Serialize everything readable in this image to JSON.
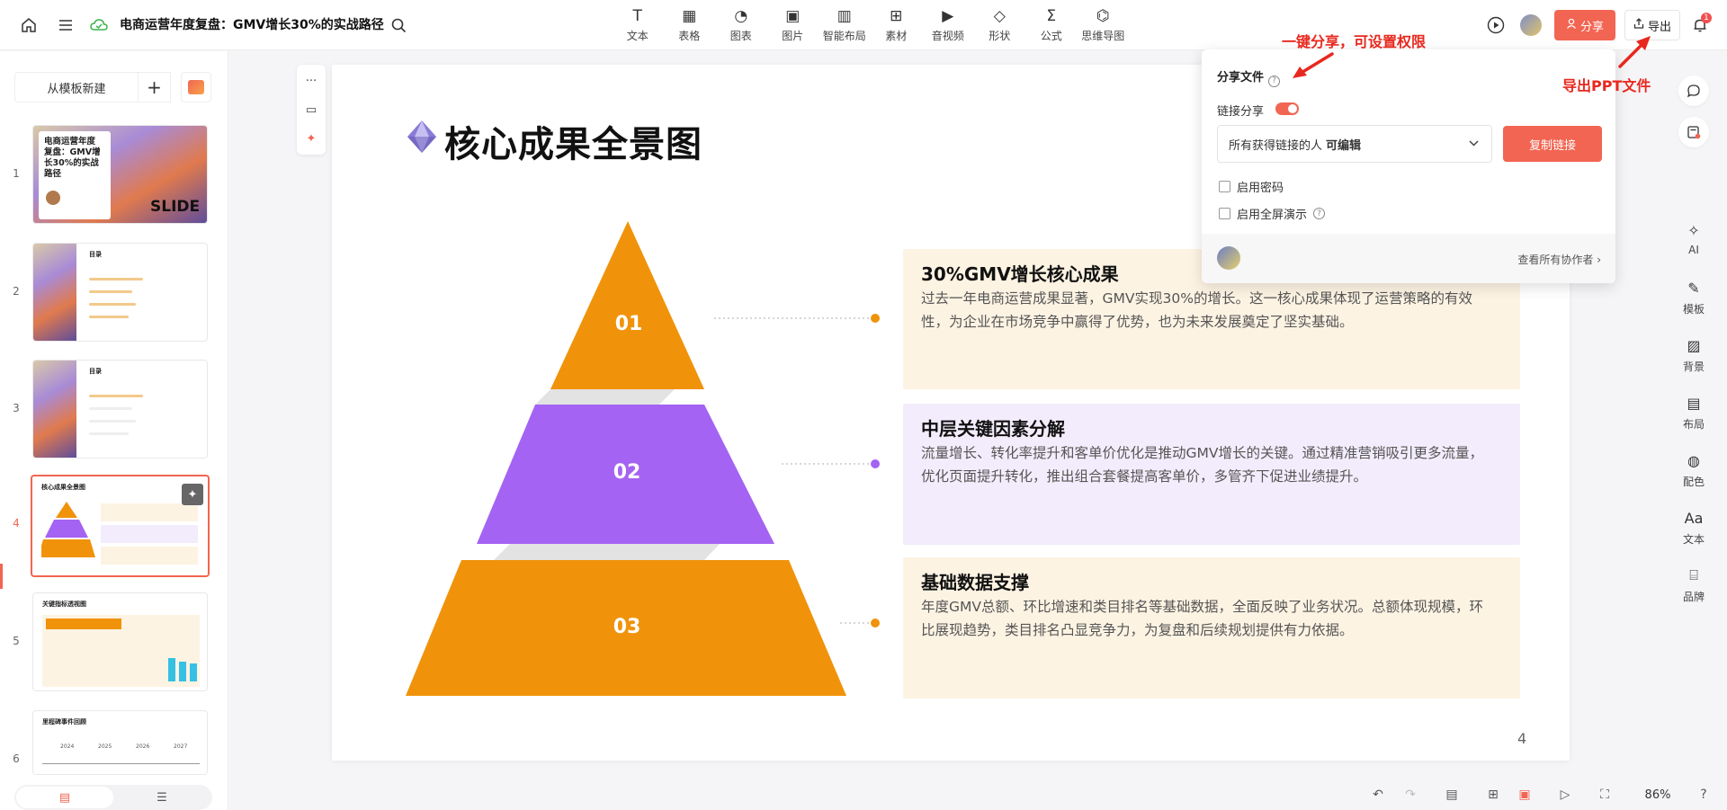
{
  "header": {
    "title": "电商运营年度复盘：GMV增长30%的实战路径",
    "tools": [
      {
        "label": "文本",
        "icon": "T"
      },
      {
        "label": "表格",
        "icon": "▦"
      },
      {
        "label": "图表",
        "icon": "◔"
      },
      {
        "label": "图片",
        "icon": "▣"
      },
      {
        "label": "智能布局",
        "icon": "▥"
      },
      {
        "label": "素材",
        "icon": "⊞"
      },
      {
        "label": "音视频",
        "icon": "▶"
      },
      {
        "label": "形状",
        "icon": "◇"
      },
      {
        "label": "公式",
        "icon": "Σ"
      },
      {
        "label": "思维导图",
        "icon": "⌬"
      }
    ],
    "share_label": "分享",
    "export_label": "导出",
    "notification_count": "1"
  },
  "left_panel": {
    "new_from_template": "从模板新建",
    "slides": [
      {
        "num": "1",
        "title": "电商运营年度复盘：GMV增长30%的实战路径",
        "tag": "SLIDE"
      },
      {
        "num": "2",
        "title": "目录"
      },
      {
        "num": "3",
        "title": "目录"
      },
      {
        "num": "4",
        "title": "核心成果全景图"
      },
      {
        "num": "5",
        "title": "关键指标透视图"
      },
      {
        "num": "6",
        "title": "里程碑事件回顾",
        "years": [
          "2024",
          "2025",
          "2026",
          "2027"
        ]
      }
    ]
  },
  "slide": {
    "title": "核心成果全景图",
    "page_number": "4",
    "levels": [
      {
        "num": "01",
        "color": "#f0930a",
        "card_bg": "#fdf3e3",
        "title": "30%GMV增长核心成果",
        "body": "过去一年电商运营成果显著，GMV实现30%的增长。这一核心成果体现了运营策略的有效性，为企业在市场竞争中赢得了优势，也为未来发展奠定了坚实基础。"
      },
      {
        "num": "02",
        "color": "#a463f2",
        "card_bg": "#f3ecfc",
        "title": "中层关键因素分解",
        "body": "流量增长、转化率提升和客单价优化是推动GMV增长的关键。通过精准营销吸引更多流量，优化页面提升转化，推出组合套餐提高客单价，多管齐下促进业绩提升。"
      },
      {
        "num": "03",
        "color": "#f0930a",
        "card_bg": "#fdf3e3",
        "title": "基础数据支撑",
        "body": "年度GMV总额、环比增速和类目排名等基础数据，全面反映了业务状况。总额体现规模，环比展现趋势，类目排名凸显竞争力，为复盘和后续规划提供有力依据。"
      }
    ]
  },
  "share_popover": {
    "title": "分享文件",
    "link_share_label": "链接分享",
    "permission_prefix": "所有获得链接的人",
    "permission_value": "可编辑",
    "copy_link": "复制链接",
    "enable_password": "启用密码",
    "enable_fullscreen": "启用全屏演示",
    "view_all_collaborators": "查看所有协作者"
  },
  "annotations": {
    "share_note": "一键分享，可设置权限",
    "export_note": "导出PPT文件"
  },
  "right_panel": {
    "items": [
      {
        "label": "AI",
        "icon": "✧"
      },
      {
        "label": "模板",
        "icon": "✎"
      },
      {
        "label": "背景",
        "icon": "▨"
      },
      {
        "label": "布局",
        "icon": "▤"
      },
      {
        "label": "配色",
        "icon": "◍"
      },
      {
        "label": "文本",
        "icon": "Aa"
      },
      {
        "label": "品牌",
        "icon": "⌸"
      }
    ]
  },
  "status_bar": {
    "zoom": "86%"
  },
  "colors": {
    "accent": "#f26552",
    "orange": "#f0930a",
    "purple": "#a463f2"
  }
}
